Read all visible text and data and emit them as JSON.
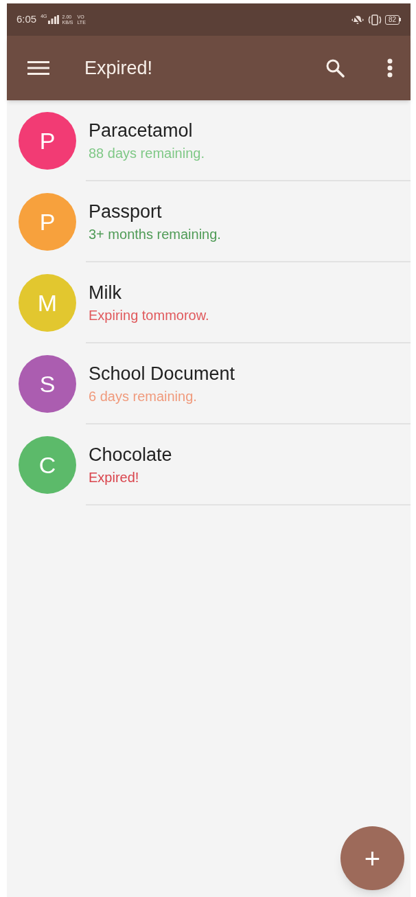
{
  "status_bar": {
    "time": "6:05",
    "network": "4G",
    "speed": "2.00",
    "speed_unit": "KB/S",
    "volte_top": "VO",
    "volte_bottom": "LTE",
    "battery": "82"
  },
  "app_bar": {
    "title": "Expired!"
  },
  "items": [
    {
      "initial": "P",
      "color": "#f23b74",
      "name": "Paracetamol",
      "status": {
        "text": "88 days remaining.",
        "color": "#7fc886"
      }
    },
    {
      "initial": "P",
      "color": "#f7a13d",
      "name": "Passport",
      "status": {
        "text": "3+ months remaining.",
        "color": "#4f9b56"
      }
    },
    {
      "initial": "M",
      "color": "#e2c72f",
      "name": "Milk",
      "status": {
        "text": "Expiring tommorow.",
        "color": "#e0595c"
      }
    },
    {
      "initial": "S",
      "color": "#ab5db0",
      "name": "School Document",
      "status": {
        "text": "6 days remaining.",
        "color": "#f09a7c"
      }
    },
    {
      "initial": "C",
      "color": "#5cba6a",
      "name": "Chocolate",
      "status": {
        "text": "Expired!",
        "color": "#d9444c"
      }
    }
  ],
  "fab": {
    "label": "+"
  }
}
